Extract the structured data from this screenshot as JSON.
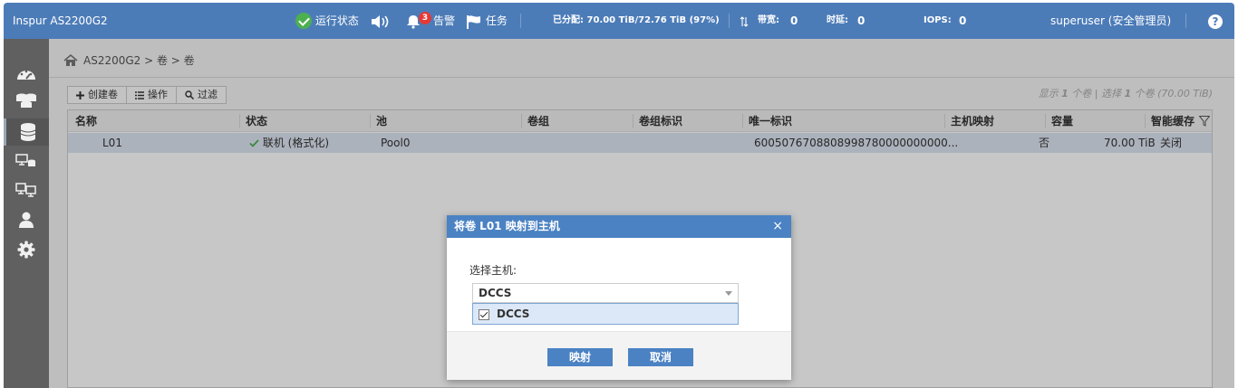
{
  "app": {
    "title": "Inspur AS2200G2"
  },
  "header": {
    "run_status_label": "运行状态",
    "alerts_count": "3",
    "alerts_label": "告警",
    "tasks_label": "任务",
    "allocated": "已分配: 70.00 TiB/72.76 TiB (97%)",
    "bandwidth_label": "带宽:",
    "bandwidth_value": "0",
    "latency_label": "时延:",
    "latency_value": "0",
    "iops_label": "IOPS:",
    "iops_value": "0",
    "user": "superuser (安全管理员)",
    "help": "?"
  },
  "breadcrumb": {
    "path": "AS2200G2 > 卷 > 卷"
  },
  "toolbar": {
    "create": "创建卷",
    "actions": "操作",
    "filter": "过滤"
  },
  "summary": {
    "prefix": "显示",
    "shown": "1",
    "mid": "个卷 | 选择",
    "selected": "1",
    "suffix": "个卷 (70.00 TiB)"
  },
  "grid": {
    "columns": [
      "名称",
      "状态",
      "池",
      "卷组",
      "卷组标识",
      "唯一标识",
      "主机映射",
      "容量",
      "智能缓存"
    ],
    "rows": [
      {
        "name": "L01",
        "status": "联机 (格式化)",
        "pool": "Pool0",
        "vg": "",
        "vg_id": "",
        "uid": "6005076708808998780000000000...",
        "host_map": "否",
        "capacity": "70.00 TiB",
        "cache": "关闭"
      }
    ]
  },
  "dialog": {
    "title": "将卷 L01 映射到主机",
    "close": "×",
    "select_label": "选择主机:",
    "selected_value": "DCCS",
    "options": [
      "DCCS"
    ],
    "ok": "映射",
    "cancel": "取消"
  },
  "colors": {
    "header": "#4c7cb8",
    "sidebar": "#606060",
    "accent": "#4b82c3",
    "row_selected": "#dde5f1"
  }
}
